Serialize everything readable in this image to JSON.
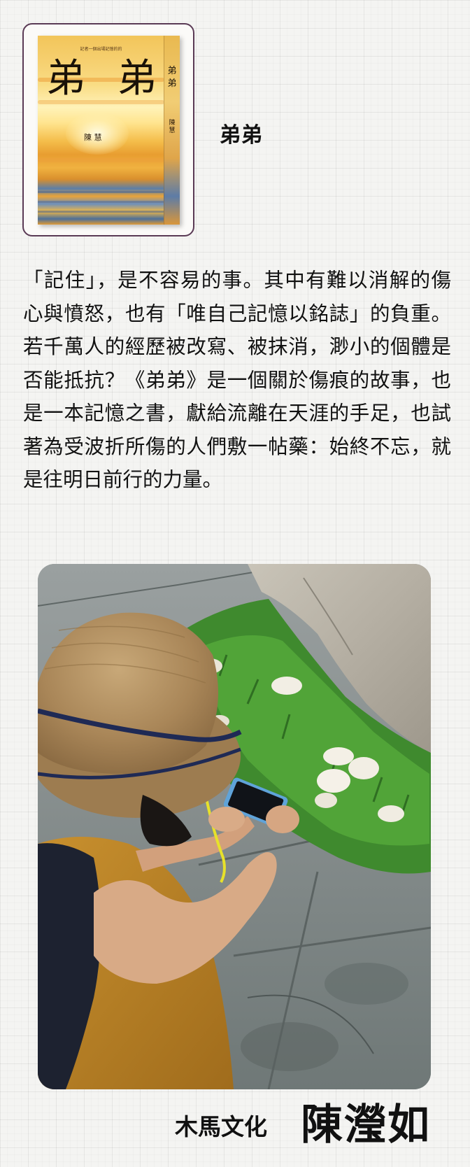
{
  "book": {
    "title": "弟弟",
    "cover": {
      "tagline": "記者一個出場記憶的的",
      "title": "弟 弟",
      "author": "陳 慧",
      "spine_title": "弟弟",
      "spine_author": "陳慧"
    }
  },
  "description": "「記住」，是不容易的事。其中有難以消解的傷心與憤怒，也有「唯自己記憶以銘誌」的負重。若千萬人的經歷被改寫、被抹消，渺小的個體是否能抵抗？《弟弟》是一個關於傷痕的故事，也是一本記憶之書，獻給流離在天涯的手足，也試著為受波折所傷的人們敷一帖藥：始終不忘，就是往明日前行的力量。",
  "footer": {
    "publisher": "木馬文化",
    "author": "陳瀅如"
  },
  "colors": {
    "cover_frame_border": "#5a3a55",
    "background": "#f4f4f2",
    "text": "#111111"
  }
}
